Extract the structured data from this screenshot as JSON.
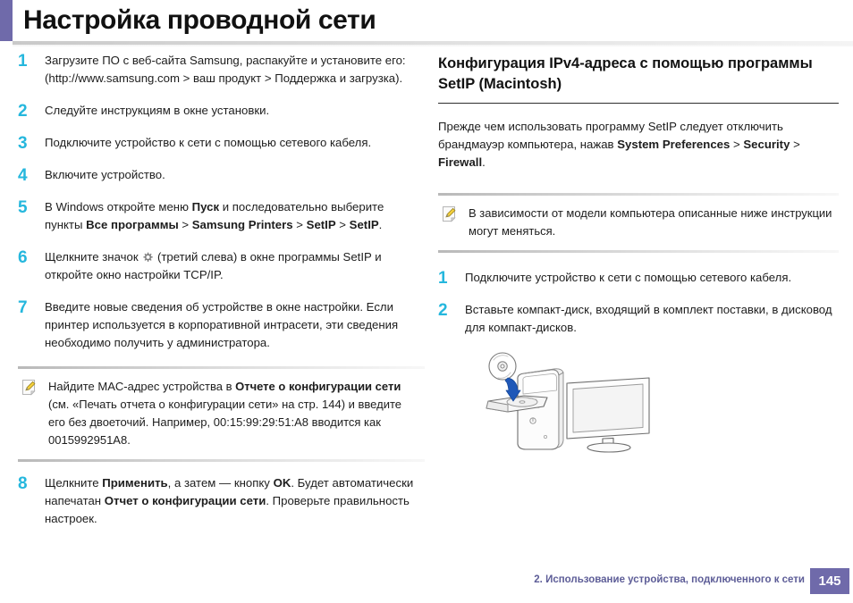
{
  "title": "Настройка проводной сети",
  "accent_color": "#6f6aaa",
  "step_number_color": "#25b7dd",
  "left_column": {
    "steps": [
      {
        "num": "1",
        "html": "Загрузите ПО с веб-сайта Samsung, распакуйте и установите его: (http://www.samsung.com &gt; ваш продукт &gt; Поддержка и загрузка)."
      },
      {
        "num": "2",
        "html": "Следуйте инструкциям в окне установки."
      },
      {
        "num": "3",
        "html": "Подключите устройство к сети с помощью сетевого кабеля."
      },
      {
        "num": "4",
        "html": "Включите устройство."
      },
      {
        "num": "5",
        "html": "В Windows откройте меню <b>Пуск</b> и последовательно выберите пункты <b>Все программы</b> &gt; <b>Samsung Printers</b> &gt; <b>SetIP</b> &gt; <b>SetIP</b>."
      },
      {
        "num": "6",
        "html": "Щелкните значок __GEAR__ (третий слева) в окне программы SetIP и откройте окно настройки TCP/IP."
      },
      {
        "num": "7",
        "html": "Введите новые сведения об устройстве в окне настройки. Если принтер используется в корпоративной интрасети, эти сведения необходимо получить у администратора."
      }
    ],
    "note": {
      "html": "Найдите MAC-адрес устройства в <b>Отчете о конфигурации сети</b> (см. «Печать отчета о конфигурации сети» на стр. 144) и введите его без двоеточий. Например, 00:15:99:29:51:A8 вводится как 0015992951A8."
    },
    "final_step": {
      "num": "8",
      "html": "Щелкните <b>Применить</b>, а затем — кнопку <b>OK</b>. Будет автоматически напечатан <b>Отчет о конфигурации сети</b>. Проверьте правильность настроек."
    }
  },
  "right_column": {
    "heading": "Конфигурация IPv4-адреса с помощью программы SetIP (Macintosh)",
    "intro_html": "Прежде чем использовать программу SetIP следует отключить брандмауэр компьютера, нажав <b>System Preferences</b> &gt; <b>Security</b> &gt; <b>Firewall</b>.",
    "note": {
      "html": "В зависимости от модели компьютера описанные ниже инструкции могут меняться."
    },
    "steps": [
      {
        "num": "1",
        "html": "Подключите устройство к сети с помощью сетевого кабеля."
      },
      {
        "num": "2",
        "html": "Вставьте компакт-диск, входящий в комплект поставки, в дисковод для компакт-дисков."
      }
    ],
    "illustration_alt": "cd-insert-into-desktop-computer-illustration"
  },
  "footer": {
    "chapter_text": "2.  Использование устройства, подключенного к сети",
    "page_number": "145",
    "badge_color": "#6f6aaa"
  }
}
